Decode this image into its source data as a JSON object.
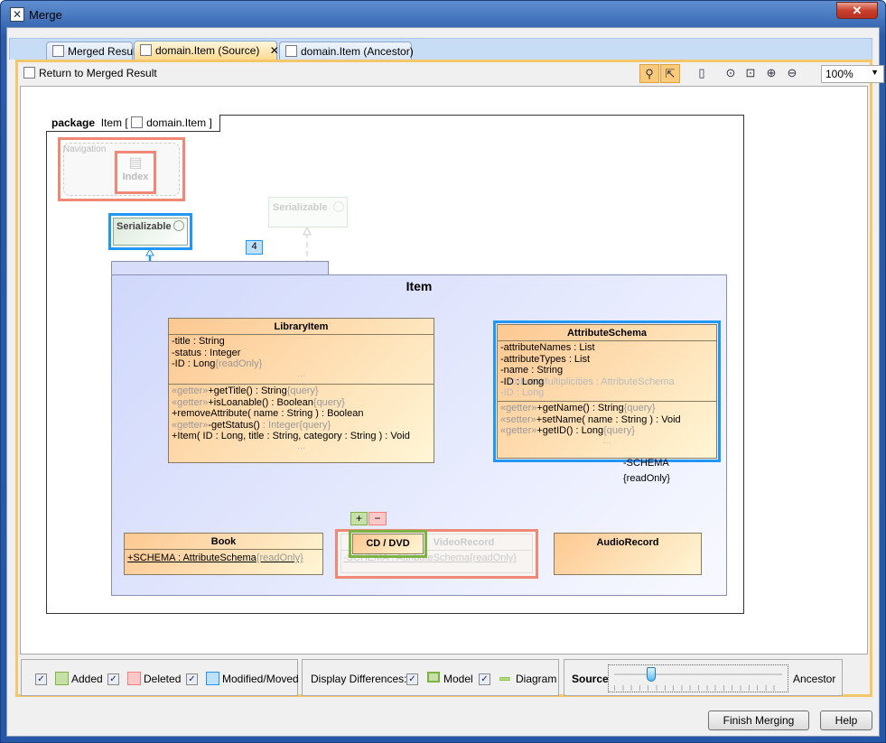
{
  "window": {
    "title": "Merge",
    "close_icon": "close-icon"
  },
  "tabs": [
    {
      "label": "Merged Result",
      "icon": "tree-icon"
    },
    {
      "label": "domain.Item (Source)",
      "icon": "diagram-icon",
      "active": true,
      "close": "✕"
    },
    {
      "label": "domain.Item (Ancestor)",
      "icon": "diagram-icon"
    }
  ],
  "toolbar": {
    "return_label": "Return to Merged Result",
    "zoom": "100%"
  },
  "diagram": {
    "package_keyword": "package",
    "package_name": "Item [",
    "package_ref": "domain.Item",
    "package_end": "]",
    "navigation": "Navigation",
    "index": "Index",
    "serializable": "Serializable",
    "serializable_ghost": "Serializable",
    "badge": "4",
    "item_pkg": "Item",
    "library_item": {
      "name": "LibraryItem",
      "attrs": [
        [
          "-title",
          " : String",
          ""
        ],
        [
          "-status",
          " : Integer",
          ""
        ],
        [
          "-ID",
          " : Long",
          "{readOnly}"
        ]
      ],
      "ops": [
        [
          "«getter»",
          "+getTitle()",
          " : String",
          "{query}"
        ],
        [
          "«getter»",
          "+isLoanable()",
          " : Boolean",
          "{query}"
        ],
        [
          "",
          "+removeAttribute( name",
          " : String ) : Boolean",
          ""
        ],
        [
          "«getter»",
          "-getStatus()",
          " : Integer",
          "{query}"
        ],
        [
          "",
          "+Item( ID : Long, title : String, category",
          " : String ) : Void",
          ""
        ]
      ]
    },
    "attribute_schema": {
      "name": "AttributeSchema",
      "attrs": [
        "-attributeNames : List",
        "-attributeTypes : List",
        "-name : String",
        "-ID : Long"
      ],
      "ghost_attrs": [
        "-attributeMultiplicities : AttributeSchema",
        "-ID : Long"
      ],
      "ops": [
        [
          "«getter»",
          "+getName()",
          " : String",
          "{query}"
        ],
        [
          "«setter»",
          "+setName( name",
          " : String ) : Void",
          ""
        ],
        [
          "«getter»",
          "+getID()",
          " : Long",
          "{query}"
        ]
      ]
    },
    "schema_role": "-SCHEMA",
    "schema_prop": "{readOnly}",
    "book": {
      "name": "Book",
      "attr": "+SCHEMA",
      "type": " : AttributeSchema",
      "prop": "{readOnly}"
    },
    "video_record": {
      "name": "VideoRecord",
      "attr": "-SCHEMA : AttributeSchema",
      "prop": "{readOnly}"
    },
    "cd_dvd": "CD / DVD",
    "audio_record": "AudioRecord",
    "added_marker": "+",
    "deleted_marker": "−"
  },
  "legend": {
    "added": "Added",
    "deleted": "Deleted",
    "modified": "Modified/Moved",
    "display_label": "Display Differences:",
    "model": "Model",
    "diagram": "Diagram",
    "colors": {
      "added": "#c6e0a8",
      "deleted": "#ffc8c8",
      "modified": "#bfe0fb",
      "added_border": "#7cb342",
      "deleted_border": "#f08080",
      "modified_border": "#2196f3"
    }
  },
  "slider": {
    "left": "Source",
    "right": "Ancestor",
    "value_percent": 22
  },
  "buttons": {
    "finish": "Finish Merging",
    "help": "Help"
  }
}
